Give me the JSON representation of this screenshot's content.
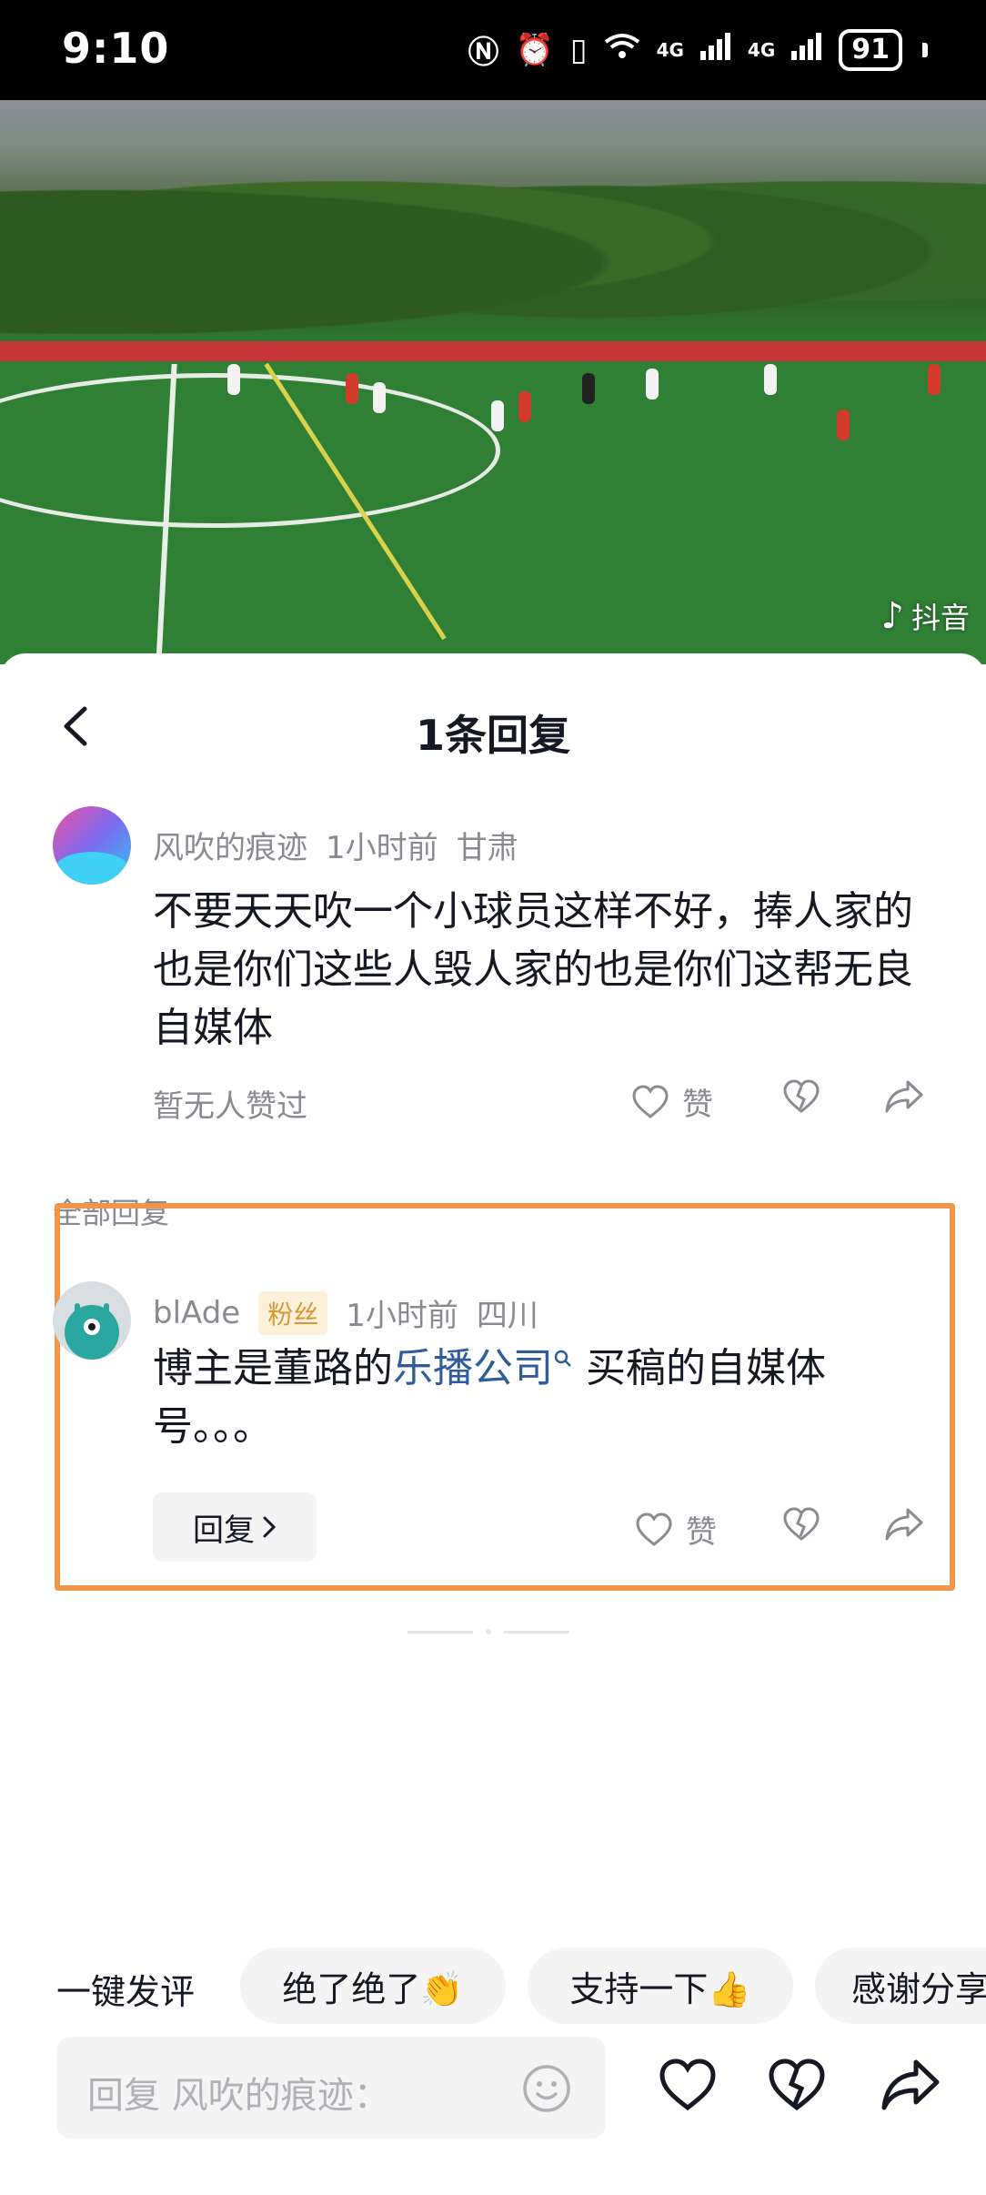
{
  "status_bar": {
    "time": "9:10",
    "network_1": "4G",
    "network_2": "4G",
    "battery": "91"
  },
  "video": {
    "watermark": "抖音",
    "icon": "douyin-logo-icon"
  },
  "header": {
    "title": "1条回复",
    "back_icon": "chevron-left-icon"
  },
  "main_comment": {
    "author": "风吹的痕迹",
    "time": "1小时前",
    "location": "甘肃",
    "text": "不要天天吹一个小球员这样不好，捧人家的也是你们这些人毁人家的也是你们这帮无良自媒体",
    "likes_text": "暂无人赞过",
    "like_label": "赞"
  },
  "section": {
    "label": "全部回复"
  },
  "reply": {
    "author": "blAde",
    "badge": "粉丝",
    "time": "1小时前",
    "location": "四川",
    "text_before": "博主是董路的",
    "link_text": "乐播公司",
    "text_after": " 买稿的自媒体号。。。",
    "reply_button": "回复",
    "like_label": "赞"
  },
  "quick_comments": {
    "label": "一键发评",
    "chips": [
      "绝了绝了👏",
      "支持一下👍",
      "感谢分享"
    ]
  },
  "input": {
    "placeholder": "回复 风吹的痕迹："
  },
  "colors": {
    "highlight": "#f0954a",
    "link": "#2f5d9a",
    "badge_bg": "#fdf0d9",
    "badge_text": "#d49a34"
  }
}
